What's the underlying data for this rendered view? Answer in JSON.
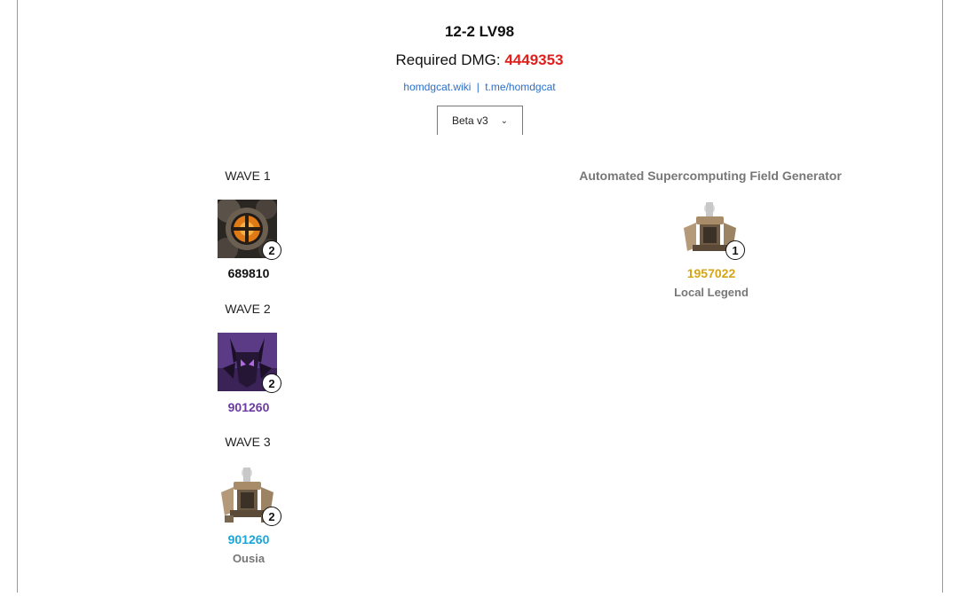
{
  "header": {
    "stage": "12-2 LV98",
    "required_label": "Required DMG:",
    "required_value": "4449353",
    "link_wiki": "homdgcat.wiki",
    "link_separator": "|",
    "link_telegram": "t.me/homdgcat",
    "version_selected": "Beta v3"
  },
  "colors": {
    "required_value": "#e0201c",
    "link": "#2a6fc9",
    "wave1_hp": "#111111",
    "wave2_hp": "#6a3ba0",
    "wave3_hp": "#1aa6d9",
    "boss_hp": "#d4a514",
    "muted": "#777777"
  },
  "waves": [
    {
      "label": "WAVE 1",
      "enemy_icon": "orange-cross-core-icon",
      "count": "2",
      "hp": "689810",
      "sub_label": ""
    },
    {
      "label": "WAVE 2",
      "enemy_icon": "purple-horned-beast-icon",
      "count": "2",
      "hp": "901260",
      "sub_label": ""
    },
    {
      "label": "WAVE 3",
      "enemy_icon": "field-generator-machine-icon",
      "count": "2",
      "hp": "901260",
      "sub_label": "Ousia"
    }
  ],
  "boss": {
    "title": "Automated Supercomputing Field Generator",
    "enemy_icon": "field-generator-machine-icon",
    "count": "1",
    "hp": "1957022",
    "sub_label": "Local Legend"
  }
}
